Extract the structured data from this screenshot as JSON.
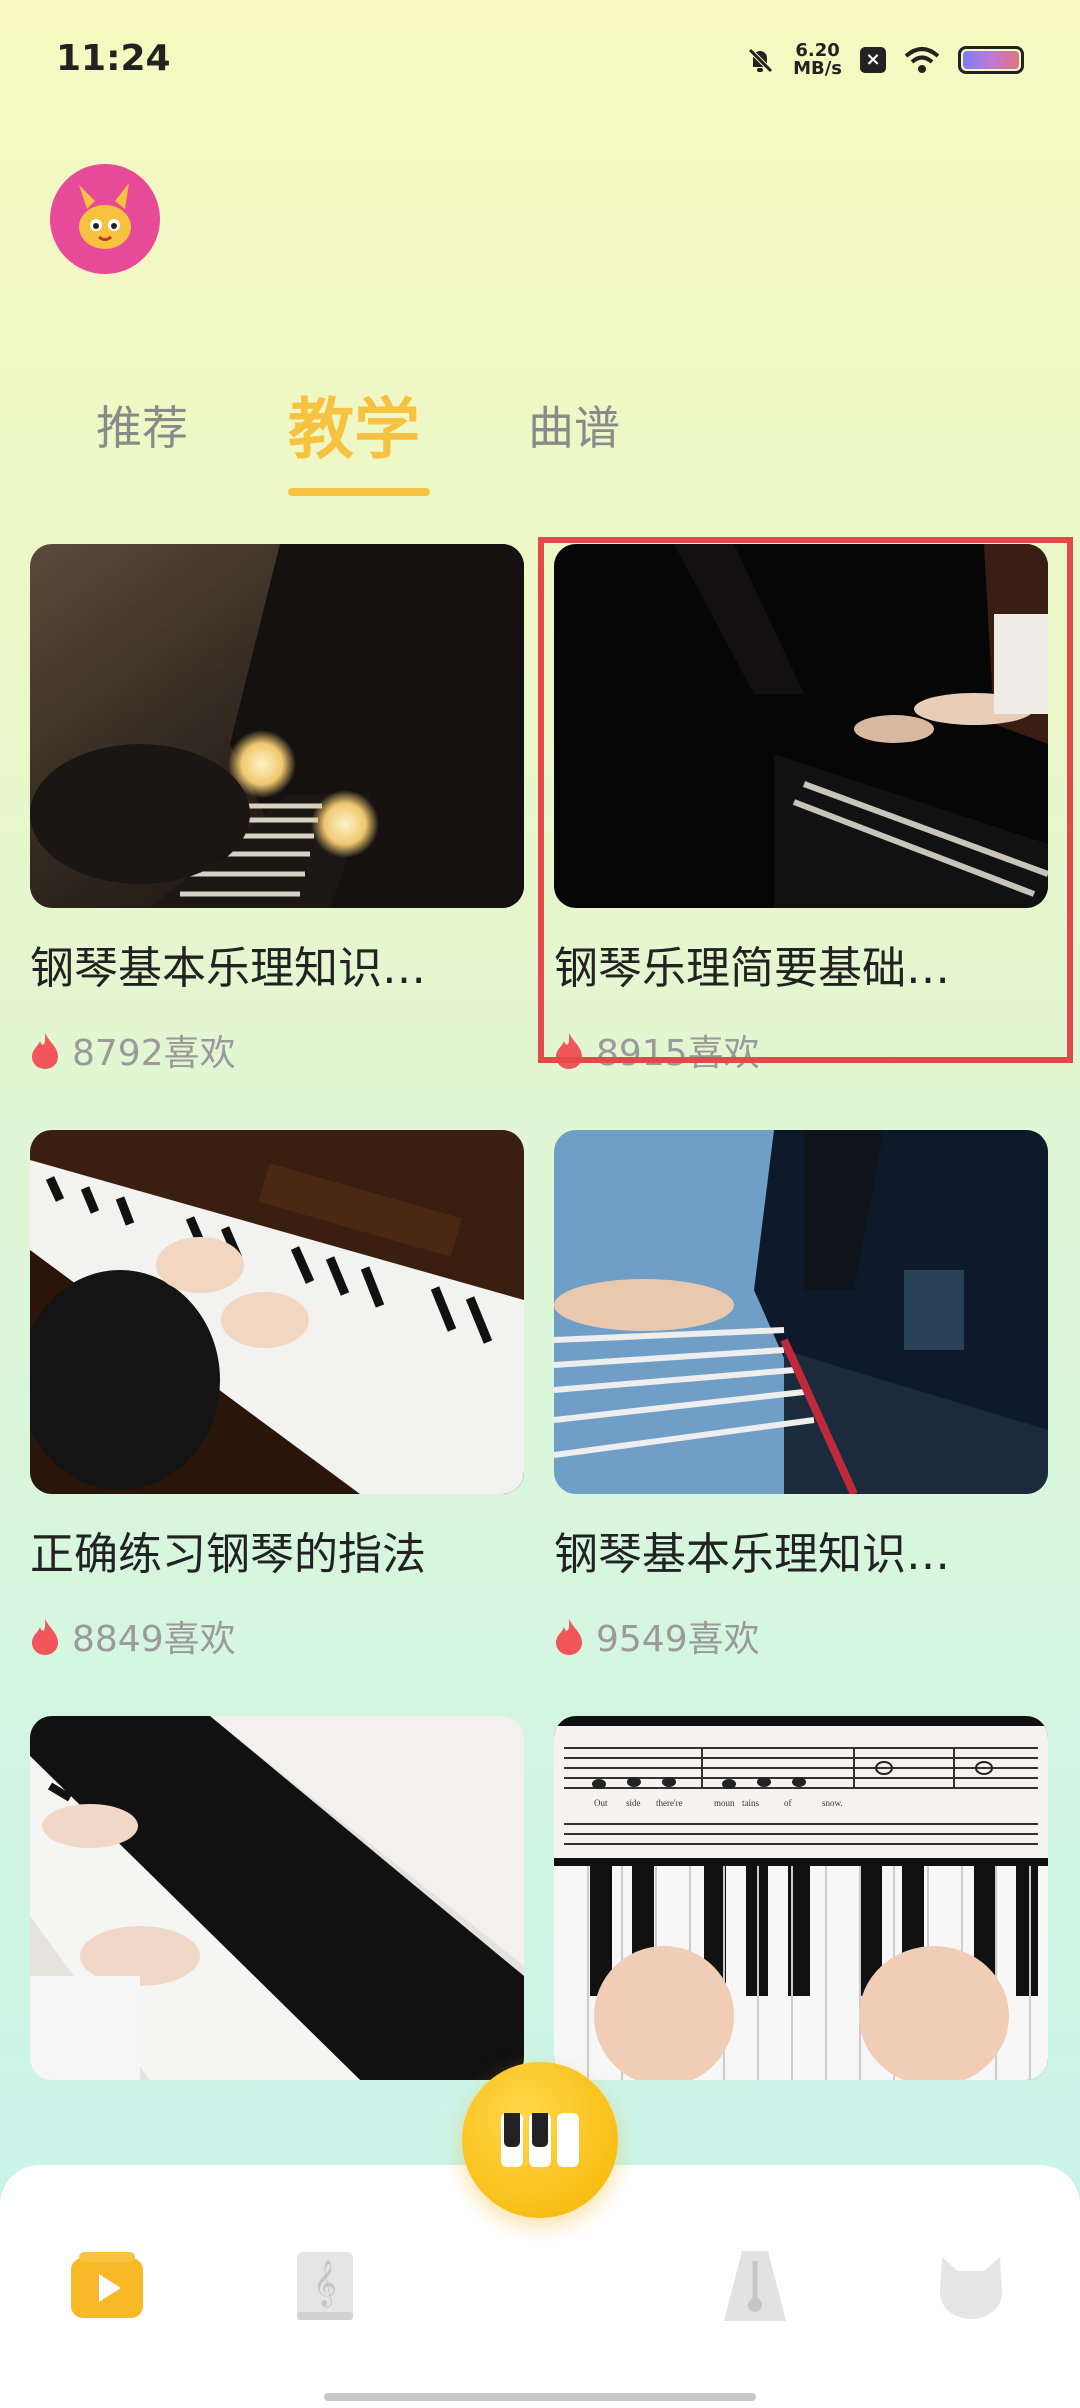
{
  "status": {
    "time": "11:24",
    "net_speed_value": "6.20",
    "net_speed_unit": "MB/s"
  },
  "tabs": [
    {
      "label": "推荐",
      "active": false
    },
    {
      "label": "教学",
      "active": true
    },
    {
      "label": "曲谱",
      "active": false
    }
  ],
  "cards": [
    {
      "title": "钢琴基本乐理知识…",
      "likes": "8792喜欢"
    },
    {
      "title": "钢琴乐理简要基础…",
      "likes": "8915喜欢"
    },
    {
      "title": "正确练习钢琴的指法",
      "likes": "8849喜欢"
    },
    {
      "title": "钢琴基本乐理知识…",
      "likes": "9549喜欢"
    },
    {
      "title": "",
      "likes": ""
    },
    {
      "title": "",
      "likes": ""
    }
  ],
  "sheet_lyrics": [
    "Out",
    "side",
    "there're",
    "moun",
    "tains",
    "of",
    "snow."
  ],
  "bottom_nav": [
    {
      "name": "video",
      "active": true
    },
    {
      "name": "sheet-music",
      "active": false
    },
    {
      "name": "piano",
      "active": false
    },
    {
      "name": "metronome",
      "active": false
    },
    {
      "name": "profile",
      "active": false
    }
  ],
  "colors": {
    "accent": "#f7c240",
    "highlight": "#e24a4a",
    "flame": "#f0565a"
  }
}
